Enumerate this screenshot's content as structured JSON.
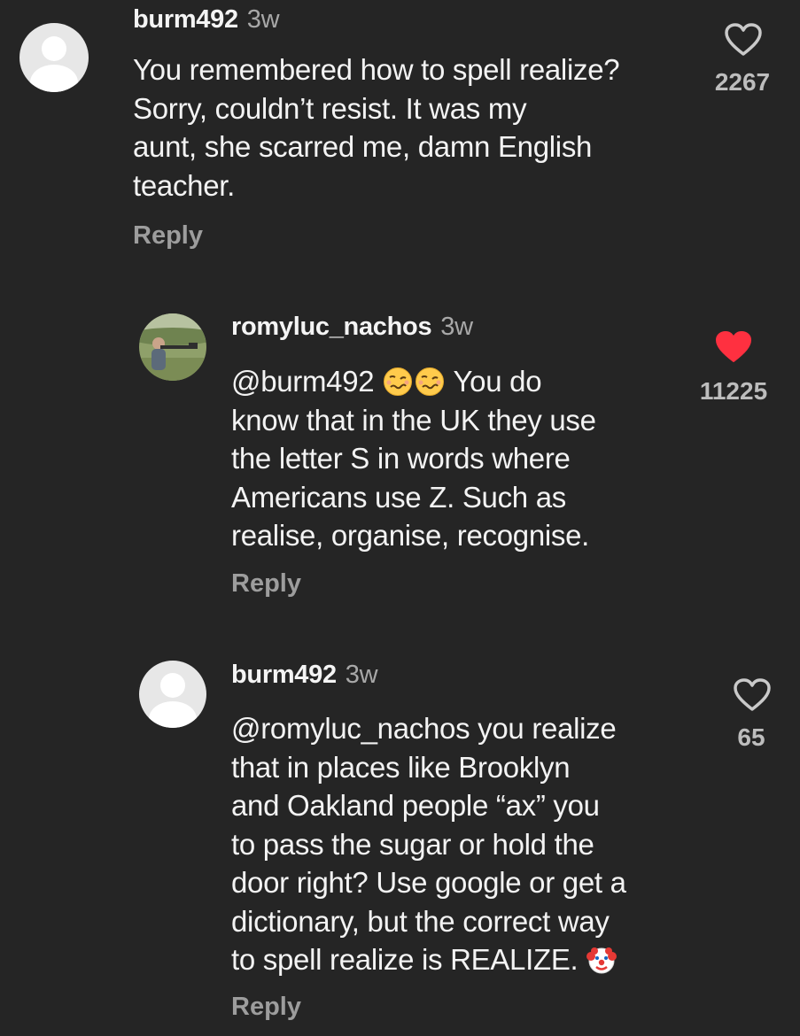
{
  "comments": [
    {
      "username": "burm492",
      "time": "3w",
      "lines": [
        "You remembered how to spell realize?",
        "Sorry, couldn’t resist.  It was my",
        "aunt, she scarred me, damn English",
        "teacher."
      ],
      "reply_label": "Reply",
      "likes": "2267",
      "liked": false,
      "avatar_icon": "default-avatar-icon"
    },
    {
      "username": "romyluc_nachos",
      "time": "3w",
      "mention": "@burm492",
      "first_line_rest": "You do",
      "emojis": [
        "woozy-face-emoji",
        "woozy-face-emoji"
      ],
      "lines": [
        "know that in the UK they use",
        "the letter S in words where",
        "Americans use Z. Such as",
        "realise, organise, recognise."
      ],
      "reply_label": "Reply",
      "likes": "11225",
      "liked": true,
      "like_color": "#ff3040",
      "avatar_icon": "profile-photo-avatar"
    },
    {
      "username": "burm492",
      "time": "3w",
      "mention": "@romyluc_nachos",
      "first_line_rest": " you realize",
      "lines": [
        "that in places like Brooklyn",
        "and Oakland people “ax” you",
        "to pass the sugar or  hold the",
        "door right?  Use google or get a",
        "dictionary, but the correct way",
        "to spell realize is REALIZE."
      ],
      "trailing_emoji": "clown-face-emoji",
      "reply_label": "Reply",
      "likes": "65",
      "liked": false,
      "avatar_icon": "default-avatar-icon"
    }
  ],
  "colors": {
    "background": "#252525",
    "text": "#f3f3f3",
    "muted": "#a8a8a8",
    "like_red": "#ff3040"
  }
}
